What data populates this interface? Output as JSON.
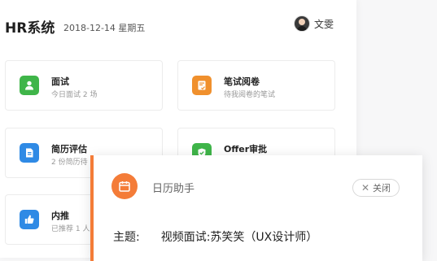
{
  "header": {
    "title": "HR系统",
    "date": "2018-12-14 星期五",
    "user_name": "文雯"
  },
  "cards": [
    {
      "title": "面试",
      "subtitle": "今日面试 2 场",
      "icon": "user-icon",
      "color": "#3fb549"
    },
    {
      "title": "笔试阅卷",
      "subtitle": "待我阅卷的笔试",
      "icon": "document-check-icon",
      "color": "#f0902d"
    },
    {
      "title": "简历评估",
      "subtitle": "2 份简历待",
      "icon": "document-icon",
      "color": "#2f8ae5"
    },
    {
      "title": "Offer审批",
      "subtitle": "",
      "icon": "check-shield-icon",
      "color": "#3fb549"
    },
    {
      "title": "内推",
      "subtitle": "已推荐 1 人",
      "icon": "thumbs-up-icon",
      "color": "#2f8ae5"
    }
  ],
  "popup": {
    "title": "日历助手",
    "close_label": "关闭",
    "subject_label": "主题:",
    "subject_value": "视频面试:苏笑笑（UX设计师）",
    "icon": "calendar-icon",
    "accent": "#f47c38"
  }
}
